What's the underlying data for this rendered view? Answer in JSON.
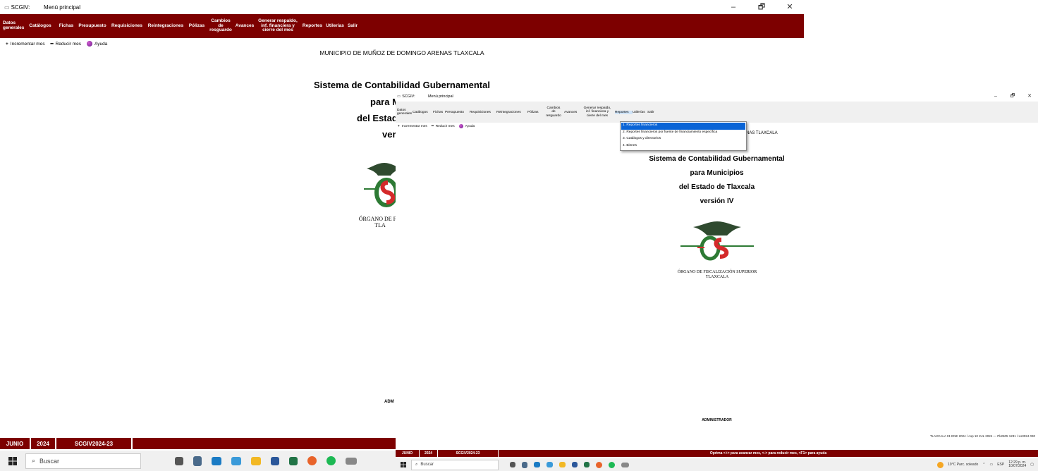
{
  "back_window": {
    "title_app": "SCGIV:",
    "title": "Menú principal",
    "controls": {
      "minimize": "–",
      "maximize": "🗗",
      "close": "✕"
    },
    "menu": [
      "Datos\ngenerales",
      "Catálogos",
      "Fichas",
      "Presupuesto",
      "Requisiciones",
      "Reintegraciones",
      "Pólizas",
      "Cambios\nde\nresguardo",
      "Avances",
      "Generar respaldo,\ninf. financiera y\ncierre del mes",
      "Reportes",
      "Utilerías",
      "Salir"
    ],
    "toolbar": {
      "increment": "Incrementar mes",
      "reduce": "Reducir mes",
      "help": "Ayuda"
    },
    "municipality": "MUNICIPIO DE MUÑOZ DE DOMINGO ARENAS TLAXCALA",
    "system_line1": "Sistema de Contabilidad Gubernamental",
    "system_line2": "para M",
    "system_line3": "del Estad",
    "system_line4": "ver",
    "logo_caption_1": "ÓRGANO DE FIS",
    "logo_caption_2": "TLA",
    "admin": "ADM",
    "status": {
      "month": "JUNIO",
      "year": "2024",
      "db": "SCGIV2024-23",
      "message": "Oprima"
    },
    "taskbar": {
      "search_placeholder": "Buscar"
    }
  },
  "front_window": {
    "title_app": "SCGIV:",
    "title": "Menú principal",
    "controls": {
      "minimize": "–",
      "maximize": "🗗",
      "close": "✕"
    },
    "menu": [
      "Datos\ngenerales",
      "Catálogos",
      "Fichas",
      "Presupuesto",
      "Requisiciones",
      "Reintegraciones",
      "Pólizas",
      "Cambios\nde\nresguardo",
      "Avances",
      "Generar respaldo,\ninf. financiera y\ncierre del mes",
      "Reportes",
      "Utilerías",
      "Salir"
    ],
    "toolbar": {
      "increment": "Incrementar mes",
      "reduce": "Reducir mes",
      "help": "Ayuda"
    },
    "municipality_tail": "NAS TLAXCALA",
    "system_line1": "Sistema de Contabilidad Gubernamental",
    "system_line2": "para Municipios",
    "system_line3": "del Estado de Tlaxcala",
    "system_line4": "versión IV",
    "logo_caption_1": "ÓRGANO DE FISCALIZACIÓN SUPERIOR",
    "logo_caption_2": "TLAXCALA",
    "admin": "ADMINISTRADOR",
    "dropdown": [
      "1. Reportes financieros",
      "2. Reportes financieros por fuente de financiamiento específica",
      "3. Catálogos y directorios",
      "4. Bienes"
    ],
    "bottom_info": "TLAXCALA  01 ENE 2024 / cop  10 JUL 2024  —  Pk2605 1231 / Ls3024 030",
    "status": {
      "month": "JUNIO",
      "year": "2024",
      "db": "SCGIV2024-23",
      "message": "Oprima <+> para avanzar mes, <-> para reducir mes, <F1> para ayuda"
    },
    "taskbar": {
      "search_placeholder": "Buscar",
      "weather": "19°C  Parc. soleado",
      "lang": "ESP",
      "time": "12:29 p. m.",
      "date": "10/07/2024"
    }
  },
  "colors": {
    "menubar": "#7d0000",
    "highlight": "#0a64d6",
    "logo_red": "#d42a2a",
    "logo_green": "#2d7a34"
  }
}
